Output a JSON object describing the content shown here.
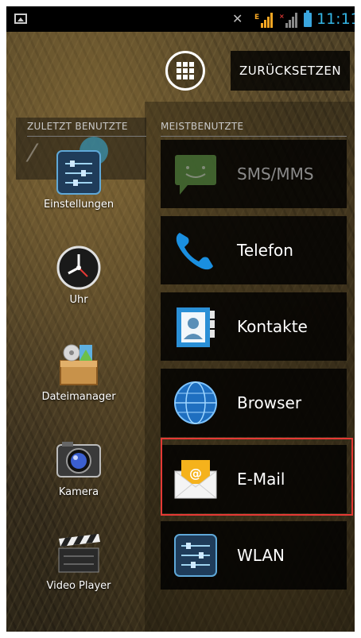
{
  "status_bar": {
    "time": "11:11",
    "accent_color": "#33b5e5",
    "icons": [
      "gallery-icon",
      "mute-icon",
      "signal-edge-icon",
      "signal-no-sim-icon",
      "battery-icon"
    ]
  },
  "top": {
    "apps_icon": "apps-grid-icon",
    "reset_label": "ZURÜCKSETZEN"
  },
  "recent": {
    "header": "ZULETZT BENUTZTE",
    "apps": [
      {
        "label": "Einstellungen",
        "icon": "settings-icon"
      },
      {
        "label": "Uhr",
        "icon": "clock-icon"
      },
      {
        "label": "Dateimanager",
        "icon": "file-manager-icon"
      },
      {
        "label": "Kamera",
        "icon": "camera-icon"
      },
      {
        "label": "Video Player",
        "icon": "video-player-icon"
      }
    ]
  },
  "most_used": {
    "header": "MEISTBENUTZTE",
    "apps": [
      {
        "label": "SMS/MMS",
        "icon": "sms-icon"
      },
      {
        "label": "Telefon",
        "icon": "phone-icon"
      },
      {
        "label": "Kontakte",
        "icon": "contacts-icon"
      },
      {
        "label": "Browser",
        "icon": "browser-icon"
      },
      {
        "label": "E-Mail",
        "icon": "email-icon",
        "highlight_color": "#e53935"
      },
      {
        "label": "WLAN",
        "icon": "wlan-settings-icon"
      }
    ]
  }
}
